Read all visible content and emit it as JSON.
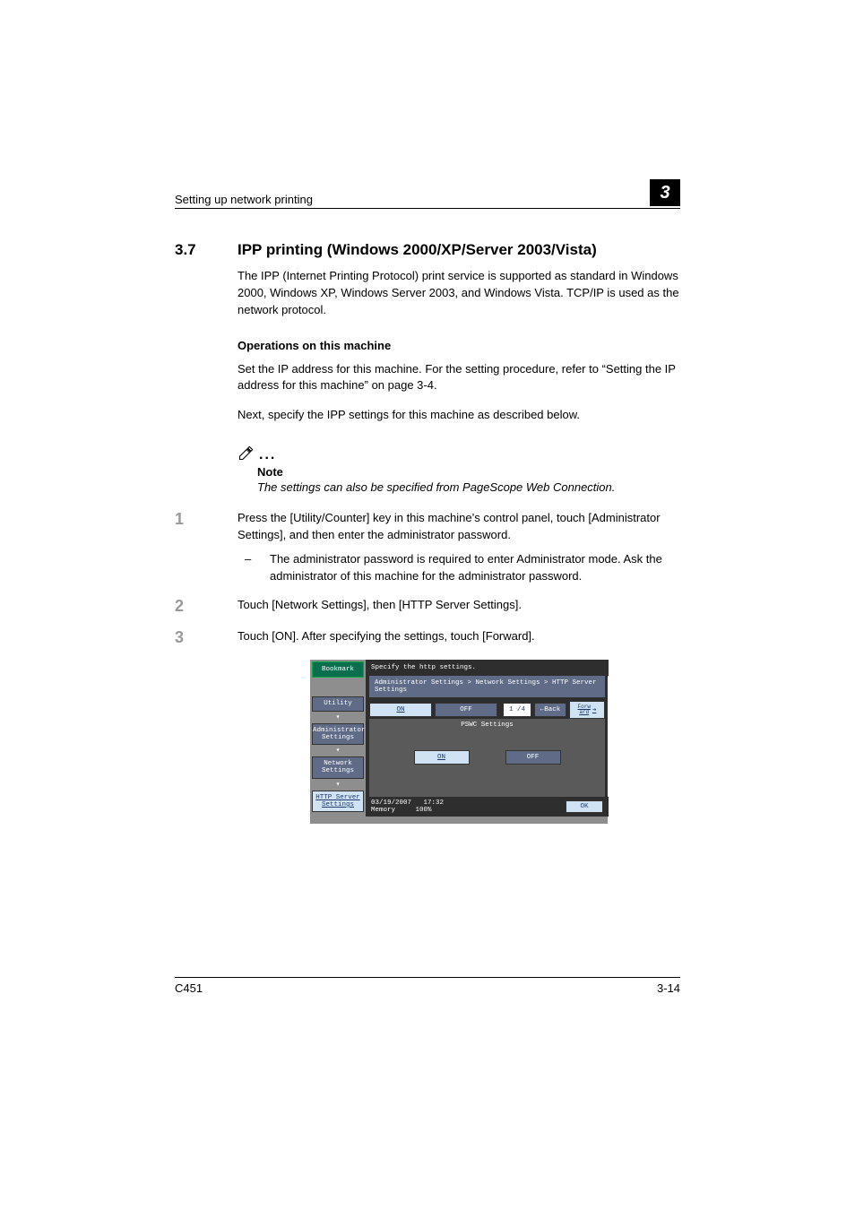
{
  "header": {
    "running_head": "Setting up network printing",
    "chapter_number": "3"
  },
  "section": {
    "number": "3.7",
    "title": "IPP printing (Windows 2000/XP/Server 2003/Vista)"
  },
  "intro": "The IPP (Internet Printing Protocol) print service is supported as standard in Windows 2000, Windows XP, Windows Server 2003, and Windows Vista. TCP/IP is used as the network protocol.",
  "ops": {
    "heading": "Operations on this machine",
    "p1": "Set the IP address for this machine. For the setting procedure, refer to “Setting the IP address for this machine” on page 3-4.",
    "p2": "Next, specify the IPP settings for this machine as described below."
  },
  "note": {
    "label": "Note",
    "text": "The settings can also be specified from PageScope Web Connection."
  },
  "steps": [
    {
      "n": "1",
      "text": "Press the [Utility/Counter] key in this machine’s control panel, touch [Administrator Settings], and then enter the administrator password.",
      "sub": "The administrator password is required to enter Administrator mode. Ask the administrator of this machine for the administrator password."
    },
    {
      "n": "2",
      "text": "Touch [Network Settings], then [HTTP Server Settings]."
    },
    {
      "n": "3",
      "text": "Touch [ON]. After specifying the settings, touch [Forward]."
    }
  ],
  "panel": {
    "bookmark": "Bookmark",
    "side": {
      "utility": "Utility",
      "admin": "Administrator\nSettings",
      "network": "Network\nSettings",
      "http": "HTTP Server\nSettings"
    },
    "title": "Specify the http settings.",
    "crumb": "Administrator Settings > Network Settings > HTTP Server Settings",
    "tabs": {
      "on": "ON",
      "off": "OFF"
    },
    "page": "1 /4",
    "back": "←Back",
    "forward": "Forw\nard",
    "body_label": "PSWC Settings",
    "body_on": "ON",
    "body_off": "OFF",
    "foot_date": "03/19/2007",
    "foot_time": "17:32",
    "foot_mem_label": "Memory",
    "foot_mem_val": "100%",
    "ok": "OK"
  },
  "footer": {
    "model": "C451",
    "page": "3-14"
  }
}
